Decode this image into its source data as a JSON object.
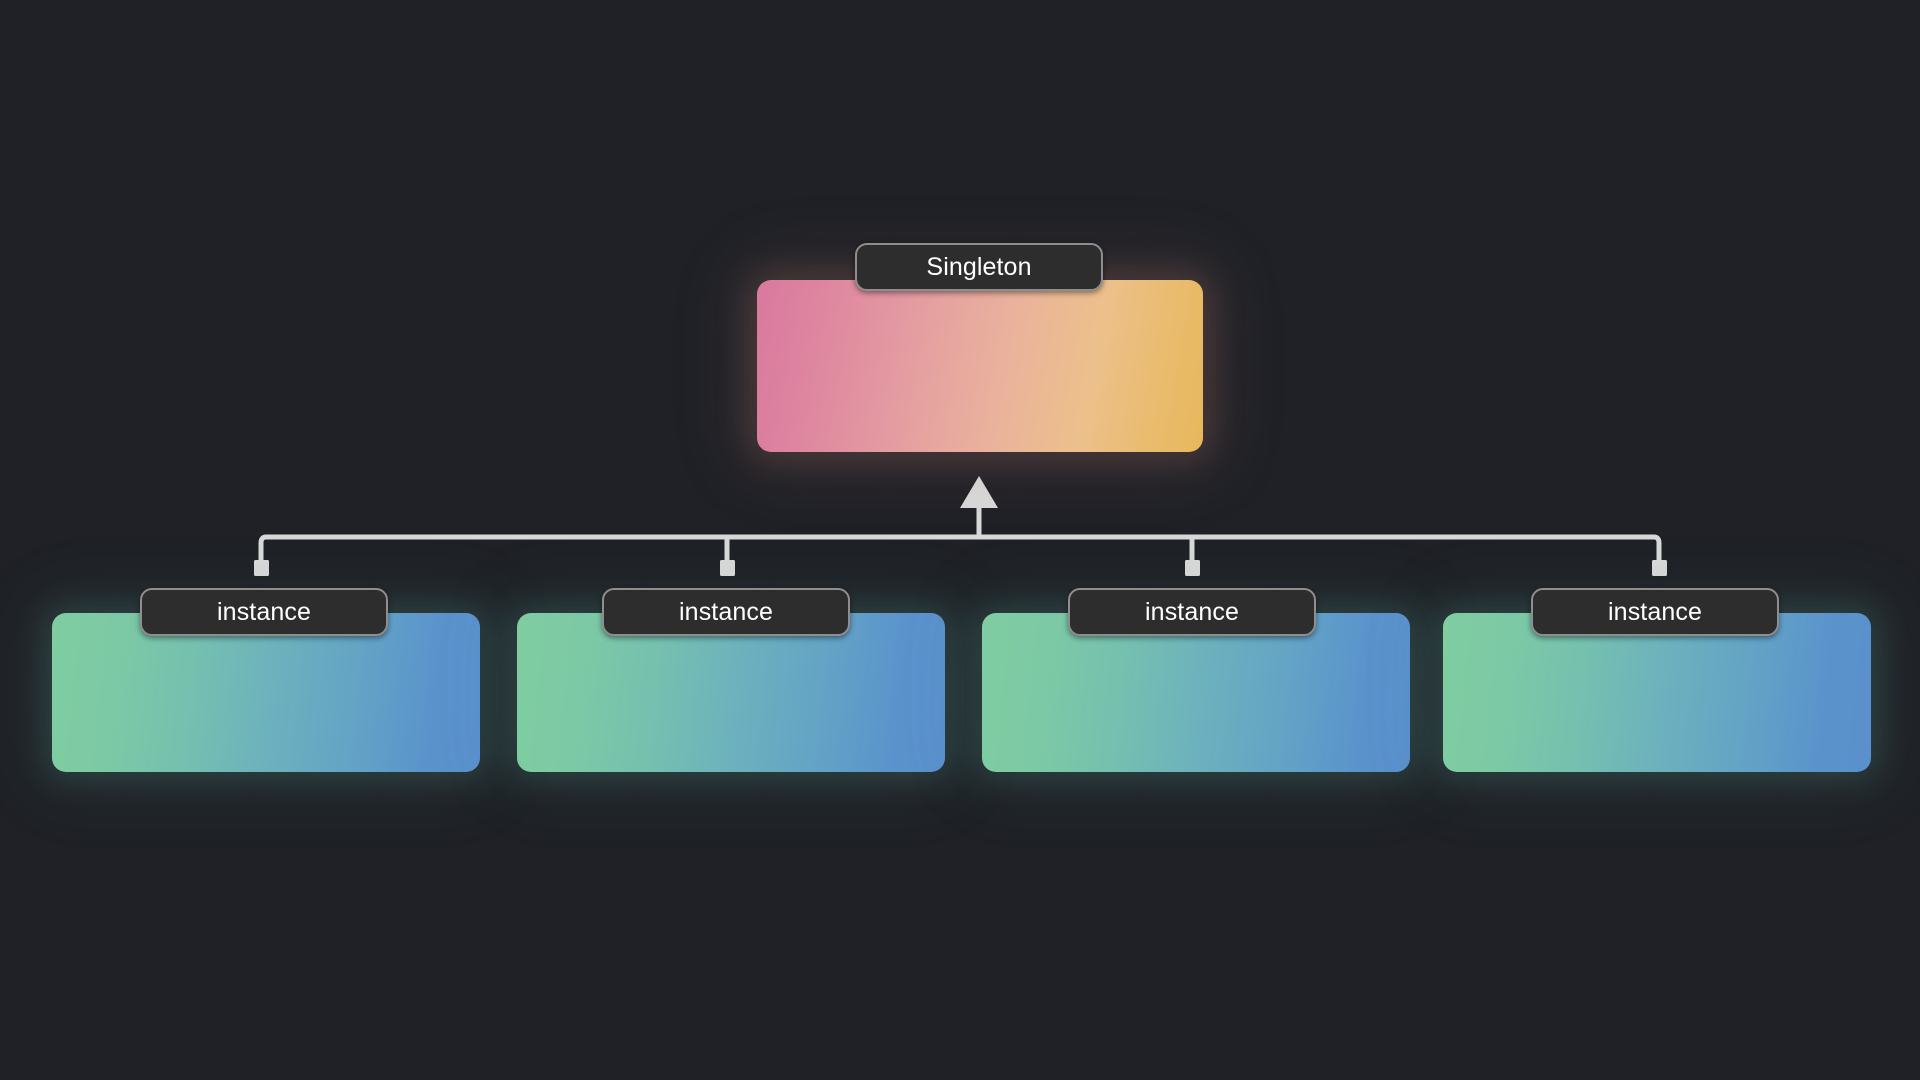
{
  "diagram": {
    "type": "singleton-pattern-diagram",
    "background_color": "#1f2126",
    "connector_color": "#d8d8d8",
    "root": {
      "label": "Singleton",
      "card": {
        "gradient_from": "#d9799e",
        "gradient_mid": "#eab29c",
        "gradient_to": "#e7b85c",
        "glow_color": "#e2967 8"
      }
    },
    "children": [
      {
        "label": "instance",
        "card": {
          "gradient_from": "#7fcda0",
          "gradient_mid": "#6cb1bd",
          "gradient_to": "#5a90cd"
        }
      },
      {
        "label": "instance",
        "card": {
          "gradient_from": "#7fcda0",
          "gradient_mid": "#6cb1bd",
          "gradient_to": "#5a90cd"
        }
      },
      {
        "label": "instance",
        "card": {
          "gradient_from": "#7fcda0",
          "gradient_mid": "#6cb1bd",
          "gradient_to": "#5a90cd"
        }
      },
      {
        "label": "instance",
        "card": {
          "gradient_from": "#7fcda0",
          "gradient_mid": "#6cb1bd",
          "gradient_to": "#5a90cd"
        }
      }
    ],
    "edges": {
      "arrow_direction": "up",
      "arrow_target": "Singleton",
      "endpoint_marker": "square",
      "endpoint_count": 4
    }
  }
}
